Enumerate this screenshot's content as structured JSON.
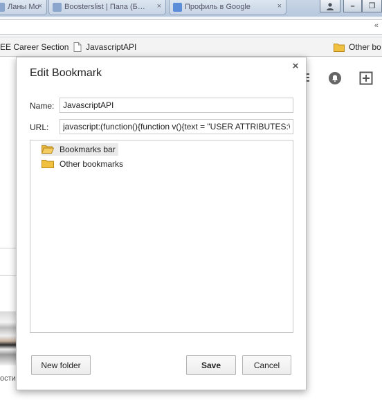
{
  "tabs": [
    {
      "label": "Ланы Мо"
    },
    {
      "label": "Boosterslist | Папа (Б…"
    },
    {
      "label": "Профиль в Google"
    }
  ],
  "window_controls": {
    "user": "user-icon",
    "minimize": "–",
    "restore": "❐"
  },
  "bookmarks_bar": {
    "items": [
      {
        "label": "EE Career Section"
      },
      {
        "label": "JavascriptAPI"
      }
    ],
    "other_label": "Other bo"
  },
  "page_background": {
    "footer_text": "ости"
  },
  "dialog": {
    "title": "Edit Bookmark",
    "close_symbol": "×",
    "name_label": "Name:",
    "name_value": "JavascriptAPI",
    "url_label": "URL:",
    "url_value": "javascript:(function(){function v(){text = \"USER ATTRIBUTES:\\n",
    "folders": [
      {
        "label": "Bookmarks bar",
        "selected": true
      },
      {
        "label": "Other bookmarks",
        "selected": false
      }
    ],
    "new_folder_label": "New folder",
    "save_label": "Save",
    "cancel_label": "Cancel"
  },
  "colors": {
    "folder": "#f0c040",
    "folder_open": "#f3cc62"
  }
}
